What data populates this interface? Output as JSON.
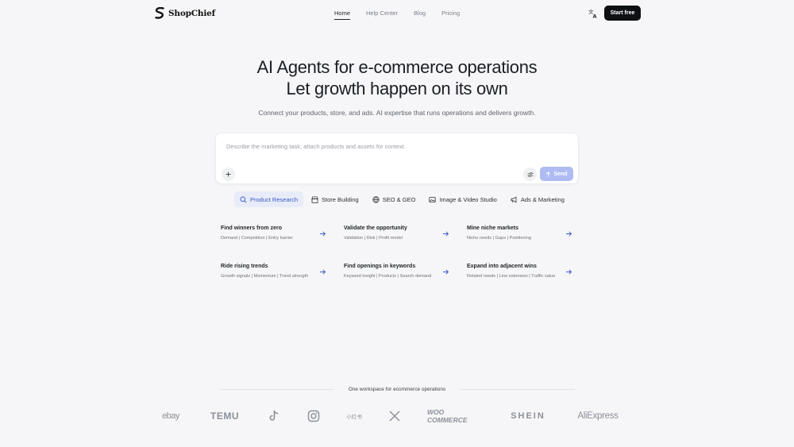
{
  "app": {
    "name": "ShopChief"
  },
  "nav": {
    "items": [
      {
        "label": "Home",
        "active": true
      },
      {
        "label": "Help Center",
        "active": false
      },
      {
        "label": "Blog",
        "active": false
      },
      {
        "label": "Pricing",
        "active": false
      }
    ],
    "language_icon": "translate-icon",
    "cta_label": "Start free"
  },
  "hero": {
    "title_line1": "AI Agents for e-commerce operations",
    "title_line2": "Let growth happen on its own",
    "subtitle": "Connect your products, store, and ads. AI expertise that runs operations and delivers growth."
  },
  "prompt": {
    "placeholder": "Describe the marketing task; attach products and assets for context.",
    "value": "",
    "attach_icon": "plus-icon",
    "settings_icon": "sliders-icon",
    "send_label": "Send"
  },
  "tabs": [
    {
      "label": "Product Research",
      "icon": "search-icon",
      "active": true
    },
    {
      "label": "Store Building",
      "icon": "store-icon",
      "active": false
    },
    {
      "label": "SEO & GEO",
      "icon": "globe-icon",
      "active": false
    },
    {
      "label": "Image & Video Studio",
      "icon": "image-icon",
      "active": false
    },
    {
      "label": "Ads & Marketing",
      "icon": "megaphone-icon",
      "active": false
    }
  ],
  "cards": [
    {
      "title": "Find winners from zero",
      "desc": "Demand | Competition | Entry barrier"
    },
    {
      "title": "Validate the opportunity",
      "desc": "Validation | Risk | Profit model"
    },
    {
      "title": "Mine niche markets",
      "desc": "Niche needs | Gaps | Positioning"
    },
    {
      "title": "Ride rising trends",
      "desc": "Growth signals | Momentum | Trend strength"
    },
    {
      "title": "Find openings in keywords",
      "desc": "Keyword insight | Products | Search demand"
    },
    {
      "title": "Expand into adjacent wins",
      "desc": "Related needs | Line extension | Traffic value"
    }
  ],
  "footer": {
    "workspace_text": "One workspace for ecommerce operations",
    "brands": [
      "ebay",
      "TEMU",
      "TikTok",
      "Instagram",
      "小红书",
      "X",
      "WOO COMMERCE",
      "SHEIN",
      "AliExpress"
    ]
  },
  "colors": {
    "accent": "#3a57c4",
    "send_button": "#aebcf3",
    "cta_background": "#0e1014",
    "page_background": "#f6f6f8"
  }
}
